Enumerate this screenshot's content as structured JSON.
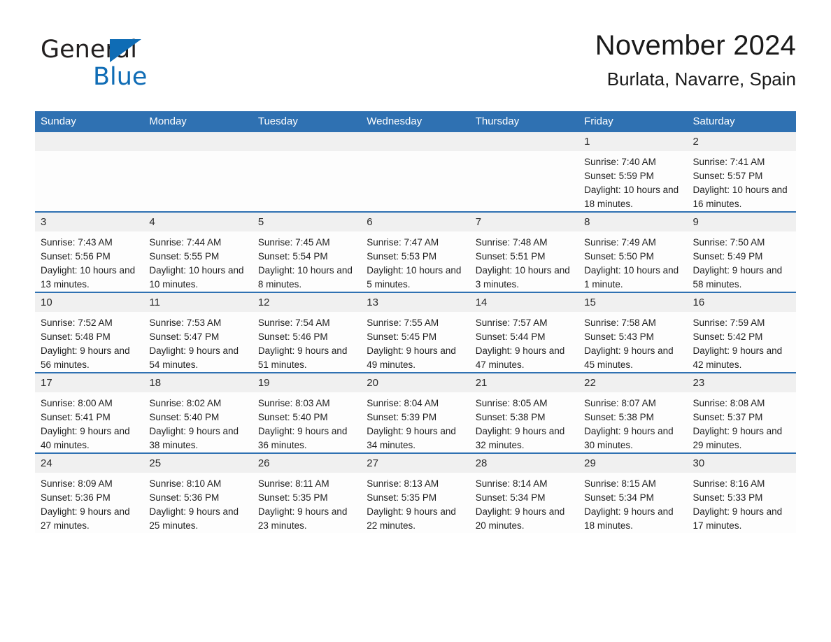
{
  "brand": {
    "name_part1": "General",
    "name_part2": "Blue",
    "triangle_icon": "blue-triangle-logo-icon"
  },
  "header": {
    "title": "November 2024",
    "subtitle": "Burlata, Navarre, Spain"
  },
  "colors": {
    "header_blue": "#2f71b2",
    "row_divider_blue": "#2f71b2",
    "daynum_band": "#f0f0f0",
    "brand_blue": "#0f6cb5",
    "page_background": "#ffffff"
  },
  "weekday_headers": [
    "Sunday",
    "Monday",
    "Tuesday",
    "Wednesday",
    "Thursday",
    "Friday",
    "Saturday"
  ],
  "weeks": [
    [
      {
        "day": "",
        "blank": true,
        "sunrise": "",
        "sunset": "",
        "daylight": ""
      },
      {
        "day": "",
        "blank": true,
        "sunrise": "",
        "sunset": "",
        "daylight": ""
      },
      {
        "day": "",
        "blank": true,
        "sunrise": "",
        "sunset": "",
        "daylight": ""
      },
      {
        "day": "",
        "blank": true,
        "sunrise": "",
        "sunset": "",
        "daylight": ""
      },
      {
        "day": "",
        "blank": true,
        "sunrise": "",
        "sunset": "",
        "daylight": ""
      },
      {
        "day": "1",
        "blank": false,
        "sunrise": "Sunrise: 7:40 AM",
        "sunset": "Sunset: 5:59 PM",
        "daylight": "Daylight: 10 hours and 18 minutes."
      },
      {
        "day": "2",
        "blank": false,
        "sunrise": "Sunrise: 7:41 AM",
        "sunset": "Sunset: 5:57 PM",
        "daylight": "Daylight: 10 hours and 16 minutes."
      }
    ],
    [
      {
        "day": "3",
        "blank": false,
        "sunrise": "Sunrise: 7:43 AM",
        "sunset": "Sunset: 5:56 PM",
        "daylight": "Daylight: 10 hours and 13 minutes."
      },
      {
        "day": "4",
        "blank": false,
        "sunrise": "Sunrise: 7:44 AM",
        "sunset": "Sunset: 5:55 PM",
        "daylight": "Daylight: 10 hours and 10 minutes."
      },
      {
        "day": "5",
        "blank": false,
        "sunrise": "Sunrise: 7:45 AM",
        "sunset": "Sunset: 5:54 PM",
        "daylight": "Daylight: 10 hours and 8 minutes."
      },
      {
        "day": "6",
        "blank": false,
        "sunrise": "Sunrise: 7:47 AM",
        "sunset": "Sunset: 5:53 PM",
        "daylight": "Daylight: 10 hours and 5 minutes."
      },
      {
        "day": "7",
        "blank": false,
        "sunrise": "Sunrise: 7:48 AM",
        "sunset": "Sunset: 5:51 PM",
        "daylight": "Daylight: 10 hours and 3 minutes."
      },
      {
        "day": "8",
        "blank": false,
        "sunrise": "Sunrise: 7:49 AM",
        "sunset": "Sunset: 5:50 PM",
        "daylight": "Daylight: 10 hours and 1 minute."
      },
      {
        "day": "9",
        "blank": false,
        "sunrise": "Sunrise: 7:50 AM",
        "sunset": "Sunset: 5:49 PM",
        "daylight": "Daylight: 9 hours and 58 minutes."
      }
    ],
    [
      {
        "day": "10",
        "blank": false,
        "sunrise": "Sunrise: 7:52 AM",
        "sunset": "Sunset: 5:48 PM",
        "daylight": "Daylight: 9 hours and 56 minutes."
      },
      {
        "day": "11",
        "blank": false,
        "sunrise": "Sunrise: 7:53 AM",
        "sunset": "Sunset: 5:47 PM",
        "daylight": "Daylight: 9 hours and 54 minutes."
      },
      {
        "day": "12",
        "blank": false,
        "sunrise": "Sunrise: 7:54 AM",
        "sunset": "Sunset: 5:46 PM",
        "daylight": "Daylight: 9 hours and 51 minutes."
      },
      {
        "day": "13",
        "blank": false,
        "sunrise": "Sunrise: 7:55 AM",
        "sunset": "Sunset: 5:45 PM",
        "daylight": "Daylight: 9 hours and 49 minutes."
      },
      {
        "day": "14",
        "blank": false,
        "sunrise": "Sunrise: 7:57 AM",
        "sunset": "Sunset: 5:44 PM",
        "daylight": "Daylight: 9 hours and 47 minutes."
      },
      {
        "day": "15",
        "blank": false,
        "sunrise": "Sunrise: 7:58 AM",
        "sunset": "Sunset: 5:43 PM",
        "daylight": "Daylight: 9 hours and 45 minutes."
      },
      {
        "day": "16",
        "blank": false,
        "sunrise": "Sunrise: 7:59 AM",
        "sunset": "Sunset: 5:42 PM",
        "daylight": "Daylight: 9 hours and 42 minutes."
      }
    ],
    [
      {
        "day": "17",
        "blank": false,
        "sunrise": "Sunrise: 8:00 AM",
        "sunset": "Sunset: 5:41 PM",
        "daylight": "Daylight: 9 hours and 40 minutes."
      },
      {
        "day": "18",
        "blank": false,
        "sunrise": "Sunrise: 8:02 AM",
        "sunset": "Sunset: 5:40 PM",
        "daylight": "Daylight: 9 hours and 38 minutes."
      },
      {
        "day": "19",
        "blank": false,
        "sunrise": "Sunrise: 8:03 AM",
        "sunset": "Sunset: 5:40 PM",
        "daylight": "Daylight: 9 hours and 36 minutes."
      },
      {
        "day": "20",
        "blank": false,
        "sunrise": "Sunrise: 8:04 AM",
        "sunset": "Sunset: 5:39 PM",
        "daylight": "Daylight: 9 hours and 34 minutes."
      },
      {
        "day": "21",
        "blank": false,
        "sunrise": "Sunrise: 8:05 AM",
        "sunset": "Sunset: 5:38 PM",
        "daylight": "Daylight: 9 hours and 32 minutes."
      },
      {
        "day": "22",
        "blank": false,
        "sunrise": "Sunrise: 8:07 AM",
        "sunset": "Sunset: 5:38 PM",
        "daylight": "Daylight: 9 hours and 30 minutes."
      },
      {
        "day": "23",
        "blank": false,
        "sunrise": "Sunrise: 8:08 AM",
        "sunset": "Sunset: 5:37 PM",
        "daylight": "Daylight: 9 hours and 29 minutes."
      }
    ],
    [
      {
        "day": "24",
        "blank": false,
        "sunrise": "Sunrise: 8:09 AM",
        "sunset": "Sunset: 5:36 PM",
        "daylight": "Daylight: 9 hours and 27 minutes."
      },
      {
        "day": "25",
        "blank": false,
        "sunrise": "Sunrise: 8:10 AM",
        "sunset": "Sunset: 5:36 PM",
        "daylight": "Daylight: 9 hours and 25 minutes."
      },
      {
        "day": "26",
        "blank": false,
        "sunrise": "Sunrise: 8:11 AM",
        "sunset": "Sunset: 5:35 PM",
        "daylight": "Daylight: 9 hours and 23 minutes."
      },
      {
        "day": "27",
        "blank": false,
        "sunrise": "Sunrise: 8:13 AM",
        "sunset": "Sunset: 5:35 PM",
        "daylight": "Daylight: 9 hours and 22 minutes."
      },
      {
        "day": "28",
        "blank": false,
        "sunrise": "Sunrise: 8:14 AM",
        "sunset": "Sunset: 5:34 PM",
        "daylight": "Daylight: 9 hours and 20 minutes."
      },
      {
        "day": "29",
        "blank": false,
        "sunrise": "Sunrise: 8:15 AM",
        "sunset": "Sunset: 5:34 PM",
        "daylight": "Daylight: 9 hours and 18 minutes."
      },
      {
        "day": "30",
        "blank": false,
        "sunrise": "Sunrise: 8:16 AM",
        "sunset": "Sunset: 5:33 PM",
        "daylight": "Daylight: 9 hours and 17 minutes."
      }
    ]
  ]
}
